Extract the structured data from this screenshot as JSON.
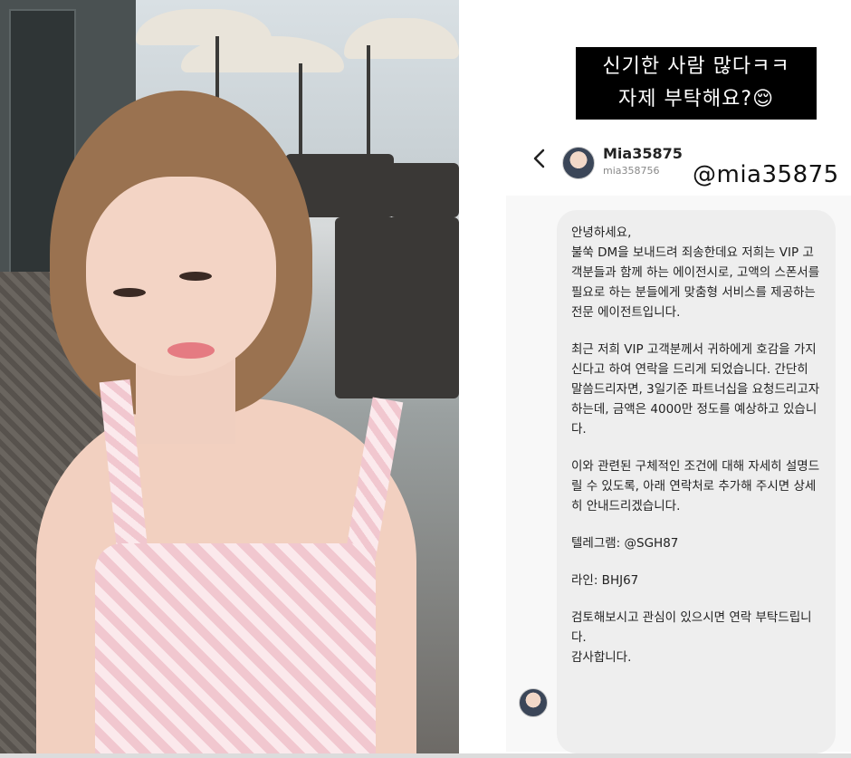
{
  "story": {
    "caption_line1": "신기한 사람 많다ㅋㅋ",
    "caption_line2": "자제 부탁해요?😌",
    "dm": {
      "display_name": "Mia35875",
      "username": "mia358756",
      "threads_handle": "@mia35875",
      "message_paragraphs": [
        "안녕하세요,\n불쑥 DM을 보내드려 죄송한데요 저희는 VIP 고객분들과 함께 하는 에이전시로, 고액의 스폰서를 필요로 하는 분들에게 맞춤형 서비스를 제공하는 전문 에이전트입니다.",
        "최근 저희 VIP 고객분께서 귀하에게 호감을 가지신다고 하여 연락을 드리게 되었습니다. 간단히 말씀드리자면, 3일기준 파트너십을 요청드리고자 하는데, 금액은 4000만 정도를 예상하고 있습니다.",
        "이와 관련된 구체적인 조건에 대해 자세히 설명드릴 수 있도록, 아래 연락처로 추가해 주시면 상세히 안내드리겠습니다.",
        "텔레그램: @SGH87",
        "라인: BHJ67",
        "검토해보시고 관심이 있으시면 연락 부탁드립니다.\n감사합니다."
      ]
    }
  },
  "icons": {
    "back": "chevron-left-icon",
    "threads": "threads-logo-icon"
  }
}
